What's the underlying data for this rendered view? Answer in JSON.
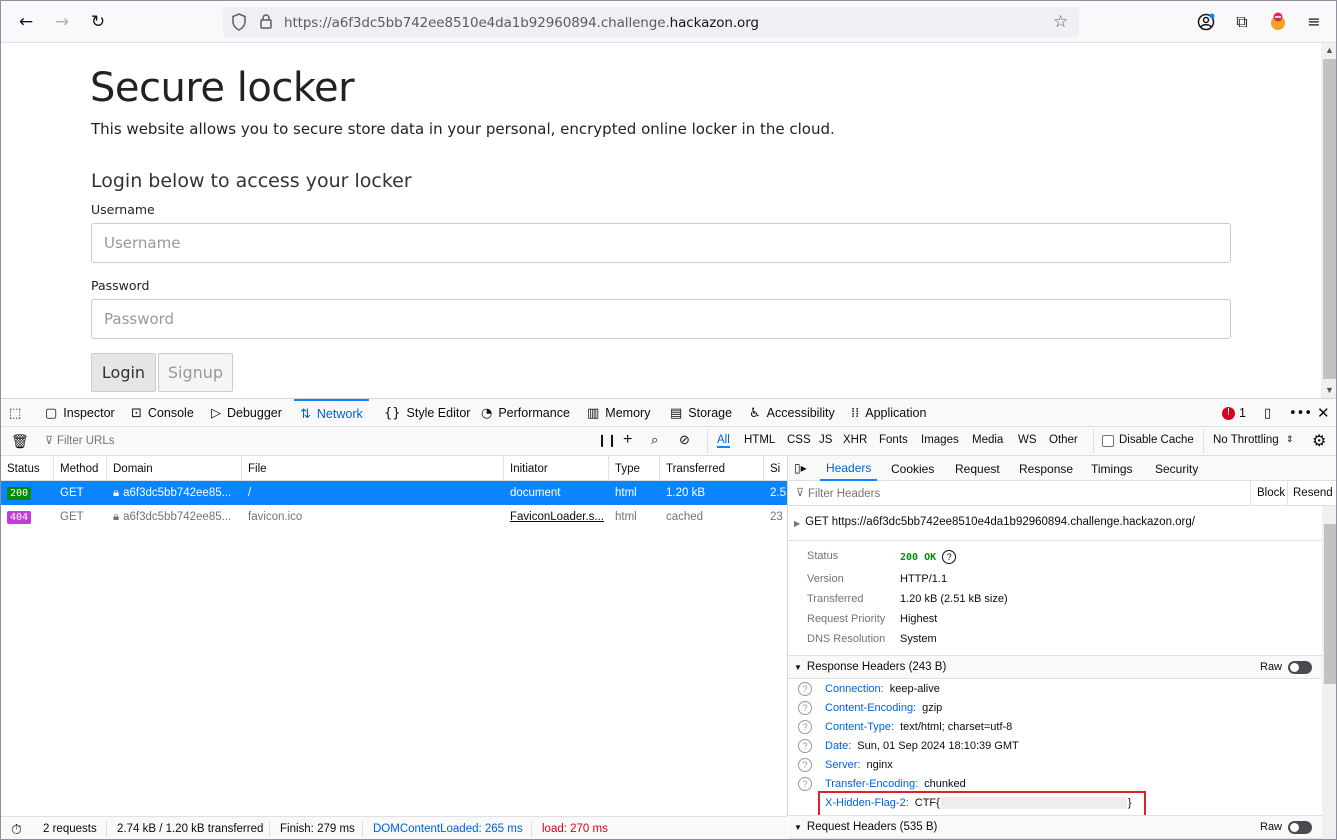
{
  "browser": {
    "url_prefix": "https://a6f3dc5bb742ee8510e4da1b92960894.challenge.",
    "url_domain": "hackazon.org"
  },
  "page": {
    "title": "Secure locker",
    "lead": "This website allows you to secure store data in your personal, encrypted online locker in the cloud.",
    "login_heading": "Login below to access your locker",
    "username_label": "Username",
    "username_placeholder": "Username",
    "password_label": "Password",
    "password_placeholder": "Password",
    "login_button": "Login",
    "signup_button": "Signup"
  },
  "devtools": {
    "tabs": [
      "Inspector",
      "Console",
      "Debugger",
      "Network",
      "Style Editor",
      "Performance",
      "Memory",
      "Storage",
      "Accessibility",
      "Application"
    ],
    "error_count": "1",
    "filter_placeholder": "Filter URLs",
    "type_filters": [
      "All",
      "HTML",
      "CSS",
      "JS",
      "XHR",
      "Fonts",
      "Images",
      "Media",
      "WS",
      "Other"
    ],
    "disable_cache": "Disable Cache",
    "throttling": "No Throttling",
    "columns": [
      "Status",
      "Method",
      "Domain",
      "File",
      "Initiator",
      "Type",
      "Transferred",
      "Si"
    ],
    "requests": [
      {
        "status": "200",
        "method": "GET",
        "domain": "a6f3dc5bb742ee85...",
        "file": "/",
        "initiator": "document",
        "type": "html",
        "transferred": "1.20 kB",
        "size": "2.5"
      },
      {
        "status": "404",
        "method": "GET",
        "domain": "a6f3dc5bb742ee85...",
        "file": "favicon.ico",
        "initiator": "FaviconLoader.s...",
        "type": "html",
        "transferred": "cached",
        "size": "23"
      }
    ],
    "stats": {
      "requests": "2 requests",
      "transferred": "2.74 kB / 1.20 kB transferred",
      "finish": "Finish: 279 ms",
      "dcl": "DOMContentLoaded: 265 ms",
      "load": "load: 270 ms"
    },
    "details": {
      "tabs": [
        "Headers",
        "Cookies",
        "Request",
        "Response",
        "Timings",
        "Security"
      ],
      "filter_placeholder": "Filter Headers",
      "block": "Block",
      "resend": "Resend",
      "request_line": "GET https://a6f3dc5bb742ee8510e4da1b92960894.challenge.hackazon.org/",
      "summary": [
        {
          "k": "Status",
          "v": "200 OK"
        },
        {
          "k": "Version",
          "v": "HTTP/1.1"
        },
        {
          "k": "Transferred",
          "v": "1.20 kB (2.51 kB size)"
        },
        {
          "k": "Request Priority",
          "v": "Highest"
        },
        {
          "k": "DNS Resolution",
          "v": "System"
        }
      ],
      "response_headers_title": "Response Headers (243 B)",
      "raw_label": "Raw",
      "response_headers": [
        {
          "k": "Connection:",
          "v": "keep-alive"
        },
        {
          "k": "Content-Encoding:",
          "v": "gzip"
        },
        {
          "k": "Content-Type:",
          "v": "text/html; charset=utf-8"
        },
        {
          "k": "Date:",
          "v": "Sun, 01 Sep 2024 18:10:39 GMT"
        },
        {
          "k": "Server:",
          "v": "nginx"
        },
        {
          "k": "Transfer-Encoding:",
          "v": "chunked"
        },
        {
          "k": "X-Hidden-Flag-2:",
          "v": "CTF{"
        }
      ],
      "flag_close": "}",
      "request_headers_title": "Request Headers (535 B)"
    }
  },
  "colors": {
    "accent": "#0a84ff",
    "selected_row": "#0a84ff",
    "ok": "#058b00",
    "not_found": "#c13dd8",
    "flag_box": "#e0202a"
  }
}
